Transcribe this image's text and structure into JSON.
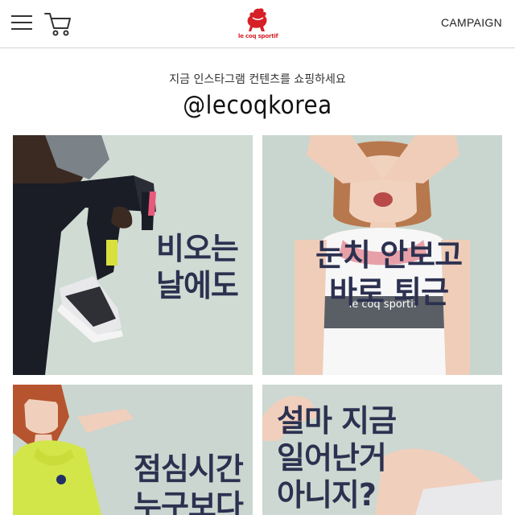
{
  "header": {
    "menu_icon": "hamburger-menu-icon",
    "cart_icon": "shopping-cart-icon",
    "logo_text": "le coq sportif",
    "campaign_label": "CAMPAIGN"
  },
  "intro": {
    "subtitle": "지금 인스타그램 컨텐츠를 쇼핑하세요",
    "handle": "@lecoqkorea"
  },
  "tiles": [
    {
      "caption": "비오는\n날에도"
    },
    {
      "caption": "눈치 안보고\n바로 퇴근",
      "shirt_text": "le coq sportif"
    },
    {
      "caption": "점심시간\n누구보다"
    },
    {
      "caption": "설마 지금\n일어난거\n아니지?"
    }
  ],
  "colors": {
    "brand_red": "#d62027",
    "caption_navy": "#2c3150",
    "tile_bg": "#cfd9d2"
  }
}
